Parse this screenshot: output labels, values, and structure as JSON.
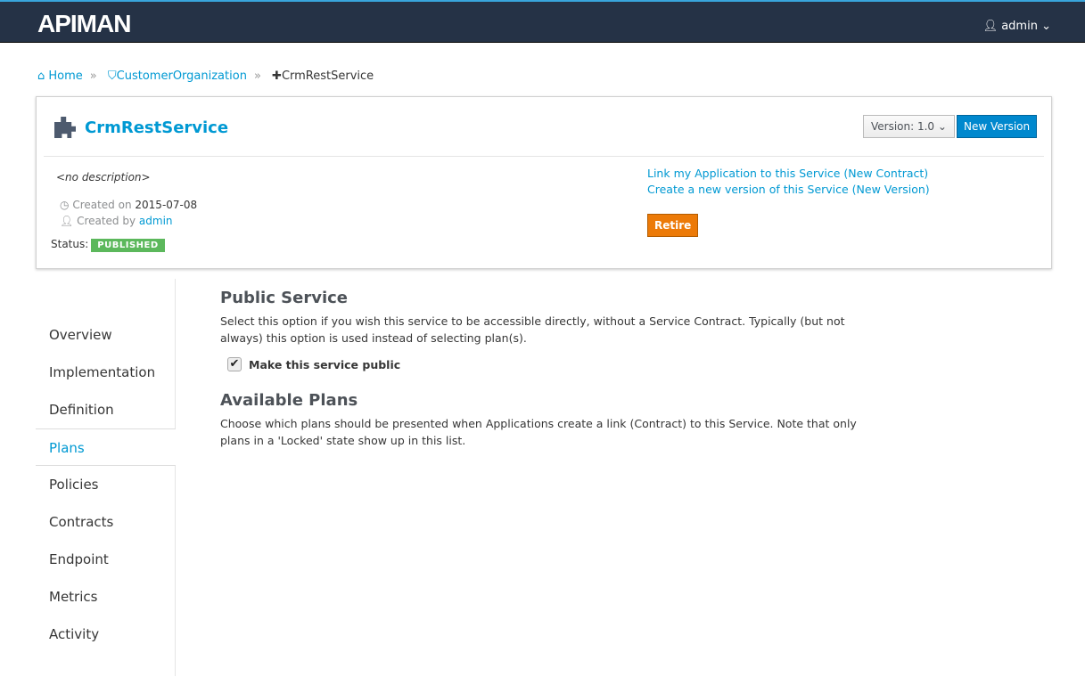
{
  "header": {
    "logo": "APIMAN",
    "user": "admin"
  },
  "breadcrumb": {
    "home": "Home",
    "org": "CustomerOrganization",
    "service": "CrmRestService"
  },
  "service": {
    "name": "CrmRestService",
    "version_label": "Version: 1.0",
    "new_version": "New Version",
    "description": "<no description>",
    "created_on_label": "Created on",
    "created_on": "2015-07-08",
    "created_by_label": "Created by",
    "created_by": "admin",
    "status_label": "Status:",
    "status": "PUBLISHED",
    "link_app": "Link my Application to this Service (New Contract)",
    "create_version": "Create a new version of this Service (New Version)",
    "retire": "Retire"
  },
  "nav": [
    "Overview",
    "Implementation",
    "Definition",
    "Plans",
    "Policies",
    "Contracts",
    "Endpoint",
    "Metrics",
    "Activity"
  ],
  "content": {
    "public_title": "Public Service",
    "public_desc": "Select this option if you wish this service to be accessible directly, without a Service Contract. Typically (but not always) this option is used instead of selecting plan(s).",
    "public_checkbox": "Make this service public",
    "plans_title": "Available Plans",
    "plans_desc": "Choose which plans should be presented when Applications create a link (Contract) to this Service. Note that only plans in a 'Locked' state show up in this list."
  }
}
